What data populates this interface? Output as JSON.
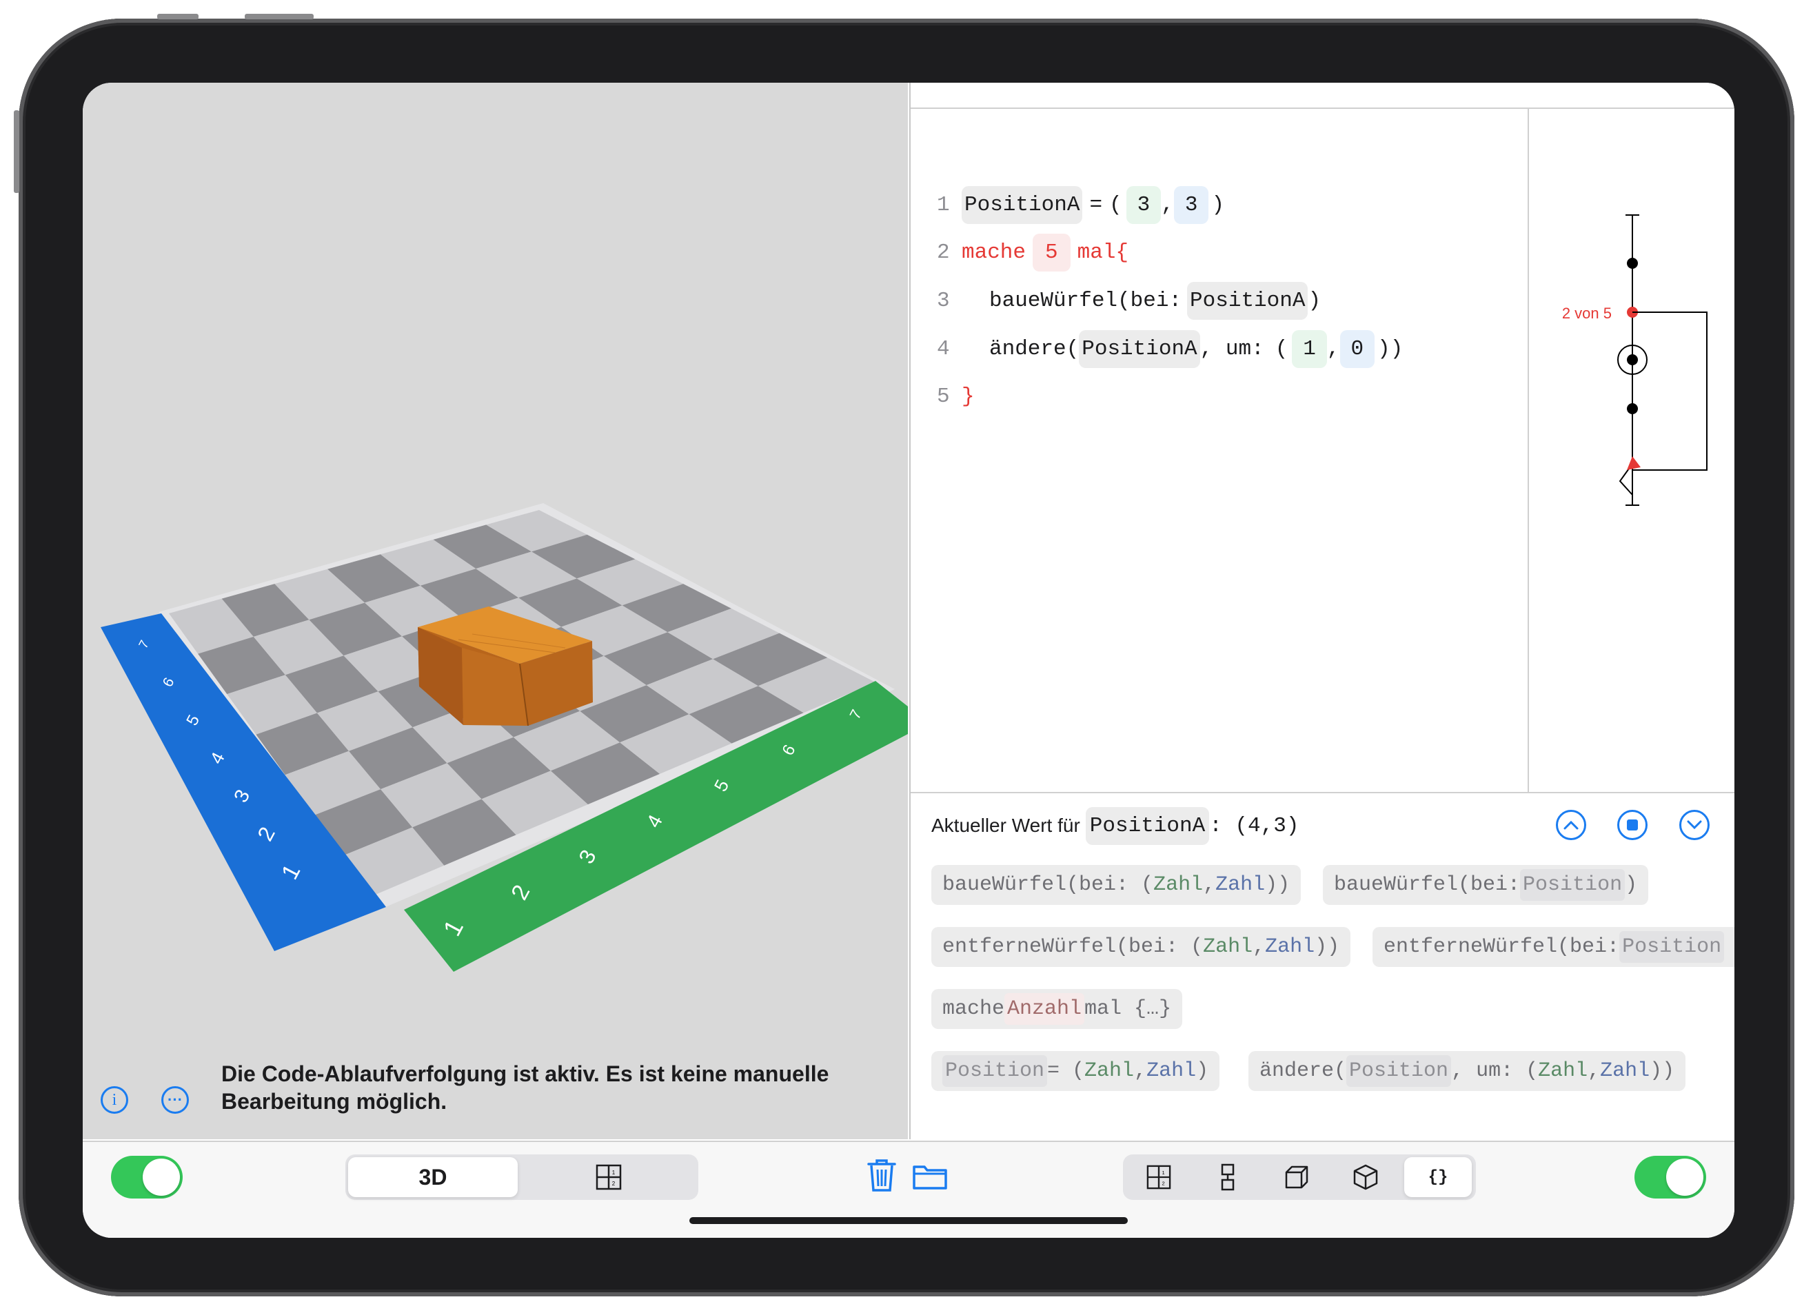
{
  "editor": {
    "lines": [
      {
        "num": "1",
        "parts": [
          "PositionA",
          "=",
          "(",
          "3",
          ",",
          "3",
          ")"
        ]
      },
      {
        "num": "2",
        "parts": [
          "mache",
          "5",
          "mal{"
        ]
      },
      {
        "num": "3",
        "parts": [
          "baueWürfel(bei:",
          "PositionA",
          ")"
        ]
      },
      {
        "num": "4",
        "parts": [
          "ändere(",
          "PositionA",
          ", um:",
          "(",
          "1",
          ",",
          "0",
          "))"
        ]
      },
      {
        "num": "5",
        "parts": [
          "}"
        ]
      }
    ]
  },
  "trace": {
    "loop_label": "2 von 5"
  },
  "status": {
    "current_prefix": "Aktueller Wert für",
    "current_var": "PositionA",
    "current_value": ": (4,3)"
  },
  "snippets": [
    {
      "id": "s1",
      "text_pre": "baueWürfel(bei: (",
      "a": "Zahl",
      "sep": ",",
      "b": "Zahl",
      "post": "))"
    },
    {
      "id": "s2",
      "text_pre": "baueWürfel(bei: ",
      "p": "Position",
      "post": ")"
    },
    {
      "id": "s3",
      "text_pre": "entferneWürfel(bei: (",
      "a": "Zahl",
      "sep": ",",
      "b": "Zahl",
      "post": "))"
    },
    {
      "id": "s4",
      "text_pre": "entferneWürfel(bei: ",
      "p": "Position",
      "post": ""
    },
    {
      "id": "s5",
      "text_pre": "mache ",
      "o": "Anzahl",
      "post": " mal {…}"
    },
    {
      "id": "s6",
      "p": "Position",
      "text_pre": " = (",
      "a": "Zahl",
      "sep": ",",
      "b": "Zahl",
      "post": ")"
    },
    {
      "id": "s7",
      "text_pre": "ändere(",
      "p": "Position",
      "mid": ", um: (",
      "a": "Zahl",
      "sep": ",",
      "b": "Zahl",
      "post": "))"
    }
  ],
  "scene": {
    "blue_axis_labels": [
      "1",
      "2",
      "3",
      "4",
      "5",
      "6",
      "7"
    ],
    "green_axis_labels": [
      "1",
      "2",
      "3",
      "4",
      "5",
      "6",
      "7"
    ],
    "message": "Die Code-Ablaufverfolgung ist aktiv. Es ist keine manuelle Bearbeitung möglich."
  },
  "toolbar": {
    "mode_3d": "3D",
    "view_code": "{}"
  },
  "colors": {
    "accent": "#1a7cf0",
    "toggle_on": "#34c759",
    "blue_axis": "#1a6fd6",
    "green_axis": "#34a853",
    "loop_red": "#e53935",
    "wood": "#c8741f"
  }
}
